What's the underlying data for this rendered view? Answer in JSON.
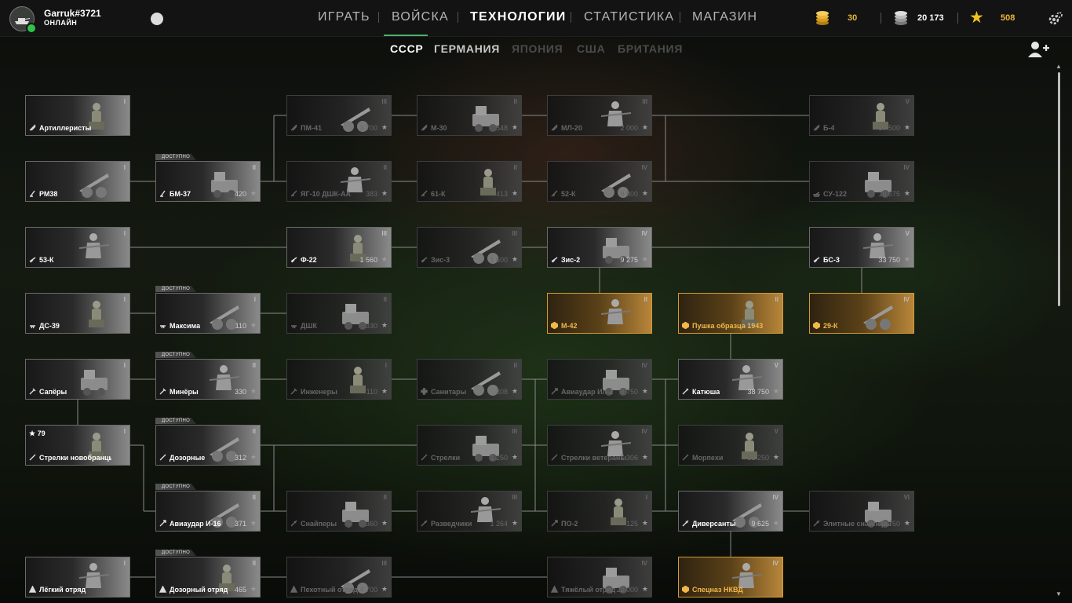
{
  "player": {
    "name": "Garruk#3721",
    "status": "ОНЛАЙН"
  },
  "nav": {
    "play": "ИГРАТЬ",
    "army": "ВОЙСКА",
    "tech": "ТЕХНОЛОГИИ",
    "stats": "СТАТИСТИКА",
    "shop": "МАГАЗИН"
  },
  "currency": {
    "gold": "30",
    "silver": "20 173",
    "stars": "508"
  },
  "nations": [
    "СССР",
    "ГЕРМАНИЯ",
    "ЯПОНИЯ",
    "США",
    "БРИТАНИЯ"
  ],
  "badge_text": "ДОСТУПНО",
  "colors": {
    "accent_green": "#4fb06a",
    "premium": "#d39a36",
    "gold": "#e8b53a",
    "star": "#f2c21b"
  },
  "units": [
    {
      "name": "Артиллеристы",
      "tier": "I",
      "icon": "artillery-icon",
      "cost": "",
      "state": "owned"
    },
    {
      "name": "ПМ-41",
      "tier": "III",
      "icon": "artillery-icon",
      "cost": "3 700",
      "state": "locked"
    },
    {
      "name": "М-30",
      "tier": "II",
      "icon": "artillery-icon",
      "cost": "548",
      "state": "locked"
    },
    {
      "name": "МЛ-20",
      "tier": "III",
      "icon": "artillery-icon",
      "cost": "2 000",
      "state": "locked"
    },
    {
      "name": "Б-4",
      "tier": "V",
      "icon": "artillery-icon",
      "cost": "37 500",
      "state": "locked"
    },
    {
      "name": "РМ38",
      "tier": "I",
      "icon": "mortar-icon",
      "cost": "",
      "state": "owned"
    },
    {
      "name": "БМ-37",
      "tier": "II",
      "icon": "mortar-icon",
      "cost": "420",
      "state": "available"
    },
    {
      "name": "ЯГ-10 ДШК-АА",
      "tier": "II",
      "icon": "aa-icon",
      "cost": "383",
      "state": "locked"
    },
    {
      "name": "61-К",
      "tier": "II",
      "icon": "aa-icon",
      "cost": "413",
      "state": "locked"
    },
    {
      "name": "52-К",
      "tier": "IV",
      "icon": "aa-icon",
      "cost": "9 800",
      "state": "locked"
    },
    {
      "name": "СУ-122",
      "tier": "IV",
      "icon": "spg-icon",
      "cost": "10 675",
      "state": "locked"
    },
    {
      "name": "53-К",
      "tier": "I",
      "icon": "atgun-icon",
      "cost": "",
      "state": "owned"
    },
    {
      "name": "Ф-22",
      "tier": "III",
      "icon": "atgun-icon",
      "cost": "1 560",
      "state": "unlocked"
    },
    {
      "name": "Зис-3",
      "tier": "III",
      "icon": "atgun-icon",
      "cost": "1 600",
      "state": "locked"
    },
    {
      "name": "Зис-2",
      "tier": "IV",
      "icon": "atgun-icon",
      "cost": "9 275",
      "state": "unlocked"
    },
    {
      "name": "БС-3",
      "tier": "V",
      "icon": "atgun-icon",
      "cost": "33 750",
      "state": "unlocked"
    },
    {
      "name": "ДС-39",
      "tier": "I",
      "icon": "mg-icon",
      "cost": "",
      "state": "owned"
    },
    {
      "name": "Максима",
      "tier": "I",
      "icon": "mg-icon",
      "cost": "110",
      "state": "available"
    },
    {
      "name": "ДШК",
      "tier": "II",
      "icon": "mg-icon",
      "cost": "330",
      "state": "locked"
    },
    {
      "name": "М-42",
      "tier": "II",
      "icon": "premium-icon",
      "cost": "",
      "state": "premium"
    },
    {
      "name": "Пушка образца 1943 года",
      "tier": "II",
      "icon": "premium-icon",
      "cost": "",
      "state": "premium"
    },
    {
      "name": "29-К",
      "tier": "IV",
      "icon": "premium-icon",
      "cost": "",
      "state": "premium"
    },
    {
      "name": "Сапёры",
      "tier": "I",
      "icon": "engineer-icon",
      "cost": "",
      "state": "owned"
    },
    {
      "name": "Минёры",
      "tier": "II",
      "icon": "engineer-icon",
      "cost": "330",
      "state": "available"
    },
    {
      "name": "Инженеры",
      "tier": "I",
      "icon": "engineer-icon",
      "cost": "110",
      "state": "locked"
    },
    {
      "name": "Санитары",
      "tier": "II",
      "icon": "medic-icon",
      "cost": "308",
      "state": "locked"
    },
    {
      "name": "Авиаудар Ил-2",
      "tier": "IV",
      "icon": "airstrike-icon",
      "cost": "8 750",
      "state": "locked"
    },
    {
      "name": "Катюша",
      "tier": "V",
      "icon": "rocket-icon",
      "cost": "38 750",
      "state": "unlocked"
    },
    {
      "name": "Стрелки новобранцы",
      "tier": "I",
      "icon": "rifle-icon",
      "cost": "",
      "state": "owned",
      "level": "79"
    },
    {
      "name": "Дозорные",
      "tier": "II",
      "icon": "rifle-icon",
      "cost": "312",
      "state": "available"
    },
    {
      "name": "Стрелки",
      "tier": "III",
      "icon": "rifle-icon",
      "cost": "1 250",
      "state": "locked"
    },
    {
      "name": "Стрелки ветераны",
      "tier": "IV",
      "icon": "rifle-icon",
      "cost": "7 306",
      "state": "locked"
    },
    {
      "name": "Морпехи",
      "tier": "V",
      "icon": "rifle-icon",
      "cost": "31 250",
      "state": "locked"
    },
    {
      "name": "Авиаудар И-16",
      "tier": "II",
      "icon": "airstrike-icon",
      "cost": "371",
      "state": "available"
    },
    {
      "name": "Снайперы",
      "tier": "II",
      "icon": "sniper-icon",
      "cost": "360",
      "state": "locked"
    },
    {
      "name": "Разведчики",
      "tier": "III",
      "icon": "sniper-icon",
      "cost": "1 264",
      "state": "locked"
    },
    {
      "name": "ПО-2",
      "tier": "I",
      "icon": "airstrike-icon",
      "cost": "125",
      "state": "locked"
    },
    {
      "name": "Диверсанты",
      "tier": "IV",
      "icon": "sniper-icon",
      "cost": "9 625",
      "state": "unlocked"
    },
    {
      "name": "Элитные снайперы",
      "tier": "VI",
      "icon": "sniper-icon",
      "cost": "43 750",
      "state": "locked"
    },
    {
      "name": "Лёгкий отряд",
      "tier": "I",
      "icon": "squad-icon",
      "cost": "",
      "state": "owned"
    },
    {
      "name": "Дозорный отряд",
      "tier": "II",
      "icon": "squad-icon",
      "cost": "465",
      "state": "available"
    },
    {
      "name": "Пехотный отряд",
      "tier": "III",
      "icon": "squad-icon",
      "cost": "4 700",
      "state": "locked"
    },
    {
      "name": "Тяжёлый отряд",
      "tier": "IV",
      "icon": "squad-icon",
      "cost": "22 000",
      "state": "locked"
    },
    {
      "name": "Спецназ НКВД",
      "tier": "IV",
      "icon": "premium-icon",
      "cost": "",
      "state": "premium"
    }
  ]
}
